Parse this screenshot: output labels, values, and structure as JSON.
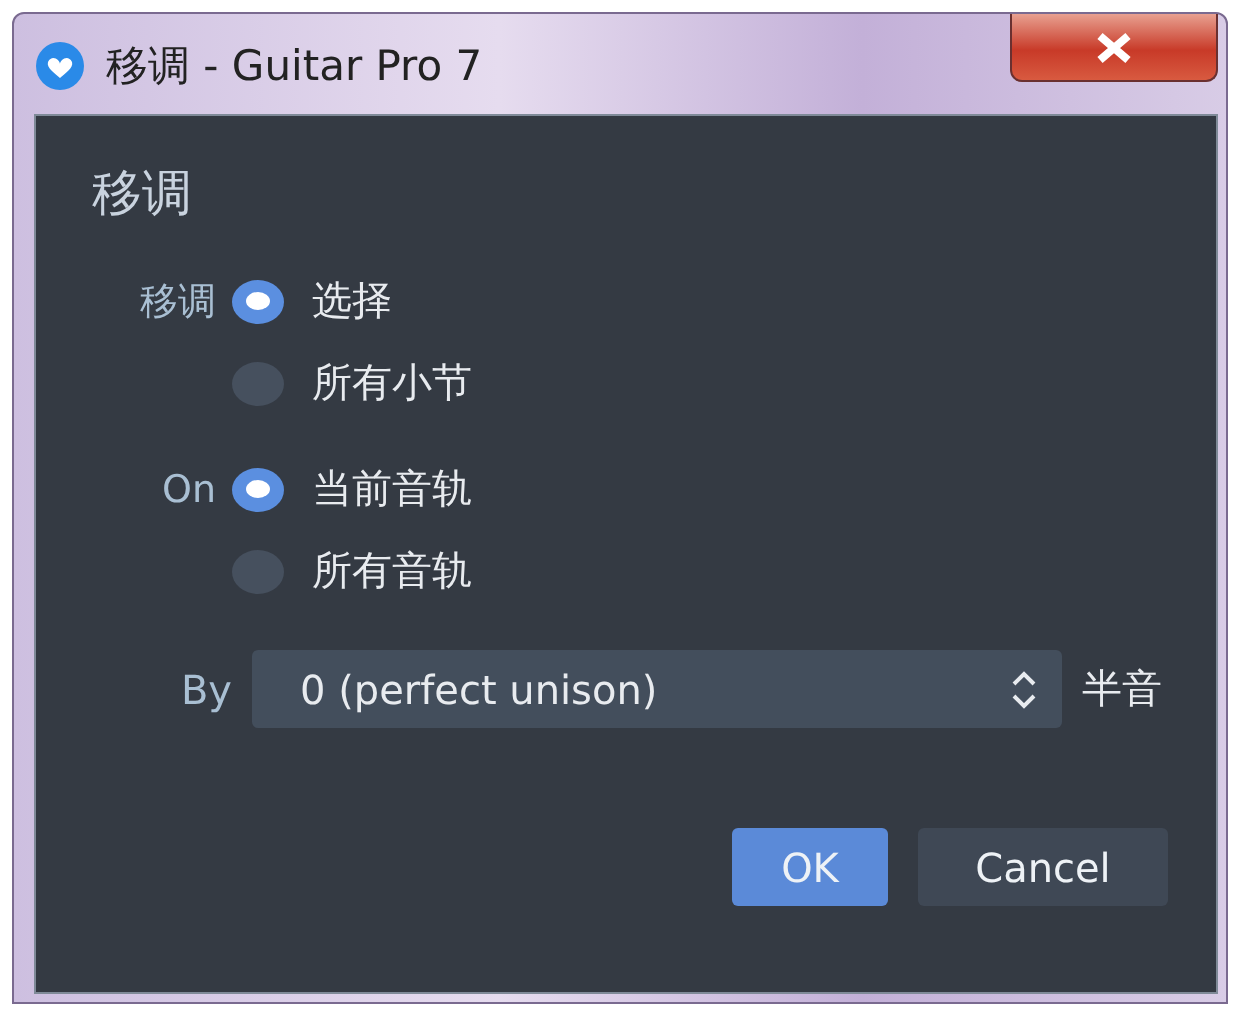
{
  "window": {
    "title": "移调 - Guitar Pro 7"
  },
  "heading": "移调",
  "groups": [
    {
      "label": "移调",
      "options": [
        {
          "label": "选择",
          "selected": true
        },
        {
          "label": "所有小节",
          "selected": false
        }
      ]
    },
    {
      "label": "On",
      "options": [
        {
          "label": "当前音轨",
          "selected": true
        },
        {
          "label": "所有音轨",
          "selected": false
        }
      ]
    }
  ],
  "by": {
    "label": "By",
    "value": "0 (perfect unison)",
    "unit": "半音"
  },
  "buttons": [
    {
      "label": "OK",
      "kind": "primary"
    },
    {
      "label": "Cancel",
      "kind": "secondary"
    }
  ]
}
